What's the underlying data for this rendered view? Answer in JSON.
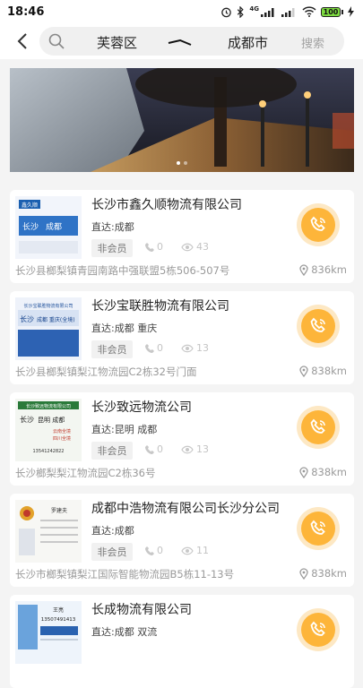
{
  "status_bar": {
    "time": "18:46",
    "network": "4G",
    "battery": "100"
  },
  "header": {
    "origin": "芙蓉区",
    "destination": "成都市",
    "search_label": "搜索"
  },
  "listings": [
    {
      "company": "长沙市鑫久顺物流有限公司",
      "direct": "直达:成都",
      "member": "非会员",
      "calls": "0",
      "views": "43",
      "address": "长沙县榔梨镇青园南路中强联盟5栋506-507号",
      "distance": "836km"
    },
    {
      "company": "长沙宝联胜物流有限公司",
      "direct": "直达:成都 重庆",
      "member": "非会员",
      "calls": "0",
      "views": "13",
      "address": "长沙县榔梨镇梨江物流园C2栋32号门面",
      "distance": "838km"
    },
    {
      "company": "长沙致远物流公司",
      "direct": "直达:昆明 成都",
      "member": "非会员",
      "calls": "0",
      "views": "13",
      "address": "长沙榔梨梨江物流园C2栋36号",
      "distance": "838km"
    },
    {
      "company": "成都中浩物流有限公司长沙分公司",
      "direct": "直达:成都",
      "member": "非会员",
      "calls": "0",
      "views": "11",
      "address": "长沙市榔梨镇梨江国际智能物流园B5栋11-13号",
      "distance": "838km"
    },
    {
      "company": "长成物流有限公司",
      "direct": "直达:成都 双流",
      "member": "",
      "calls": "",
      "views": "",
      "address": "",
      "distance": ""
    }
  ],
  "business_cards": [
    {
      "brand": "鑫久顺",
      "route_from": "长沙",
      "route_to": "成都",
      "note": "(专线直达)"
    },
    {
      "brand": "长沙宝联胜物流有限公司",
      "route_from": "长沙",
      "route_to": "成都 重庆(全境)"
    },
    {
      "brand": "长沙致远物流有限公司",
      "route_from": "长沙",
      "route_to": "昆明 成都",
      "note_a": "云南全境",
      "note_b": "四川全境",
      "phone": "13541242822"
    },
    {
      "brand": "罗建夫"
    },
    {
      "brand": "王亮",
      "phone": "13507491413"
    }
  ],
  "icons": {
    "back": "chevron-left-icon",
    "search": "search-icon",
    "route": "arrow-right-icon",
    "phone": "phone-icon",
    "eye": "eye-icon",
    "location": "location-pin-icon"
  },
  "colors": {
    "accent": "#fdb53a",
    "accent_glow": "#fde8c4",
    "muted_text": "#9a9a9a"
  }
}
